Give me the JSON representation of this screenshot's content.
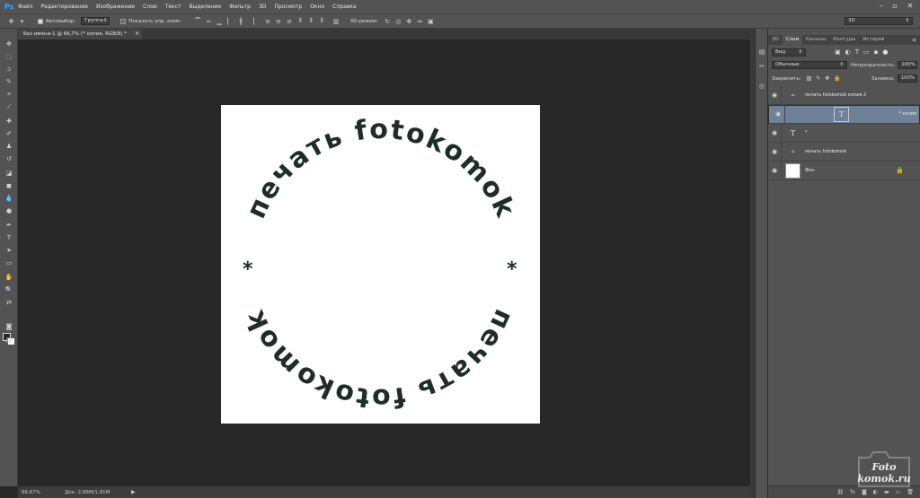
{
  "app": {
    "logo": "Ps"
  },
  "menu": [
    "Файл",
    "Редактирование",
    "Изображение",
    "Слои",
    "Текст",
    "Выделение",
    "Фильтр",
    "3D",
    "Просмотр",
    "Окно",
    "Справка"
  ],
  "options": {
    "autoselect_label": "Автовыбор:",
    "autoselect_value": "Группа",
    "show_controls_label": "Показать упр. элем.",
    "mode_3d_label": "3D-режим:",
    "workspace": "3D"
  },
  "document": {
    "tab_title": "Без имени-1 @ 66,7% (* копия, RGB/8) *",
    "arc_text_top": "печать fotokomok",
    "arc_text_bottom": "печать fotokomok",
    "star": "*"
  },
  "status": {
    "zoom": "66,67%",
    "doc_size": "Док: 2,86M/1,91M"
  },
  "panel": {
    "tabs": [
      "3D",
      "Слои",
      "Каналы",
      "Контуры",
      "История"
    ],
    "active_tab": "Слои",
    "filter_label": "Вид",
    "blend_mode": "Обычные",
    "opacity_label": "Непрозрачность:",
    "opacity_value": "100%",
    "lock_label": "Закрепить:",
    "fill_label": "Заливка:",
    "fill_value": "100%",
    "layers": [
      {
        "name": "печать fotokomok копия 2",
        "thumb": "warp",
        "selected": false
      },
      {
        "name": "* копия",
        "thumb": "text",
        "selected": true
      },
      {
        "name": "*",
        "thumb": "T",
        "selected": false
      },
      {
        "name": "печать fotokomok",
        "thumb": "warp",
        "selected": false
      },
      {
        "name": "Фон",
        "thumb": "white",
        "selected": false
      }
    ]
  },
  "watermark": {
    "line1": "Foto",
    "line2": "komok.ru"
  }
}
